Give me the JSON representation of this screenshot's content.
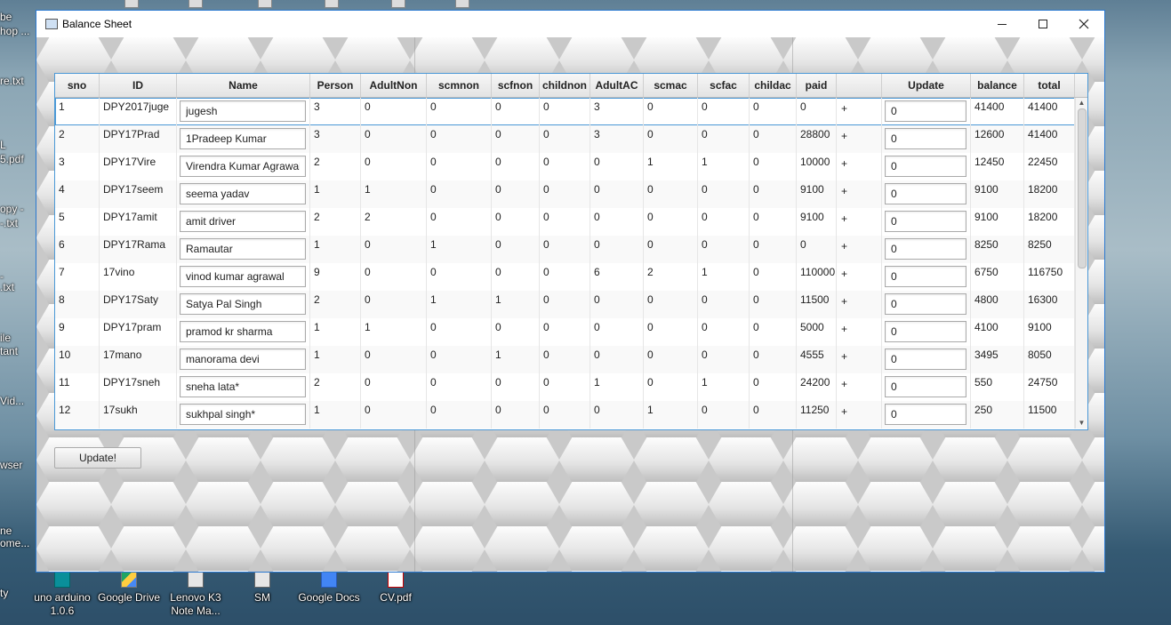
{
  "window": {
    "title": "Balance Sheet"
  },
  "desktop_left": [
    "be",
    "hop ...",
    "re.txt",
    "L",
    "5.pdf",
    "opy -",
    "-.txt",
    "-",
    ".txt",
    "ile",
    "tant",
    "Vid...",
    "wser",
    "ne",
    "ome...",
    "ty"
  ],
  "desktop_bottom": [
    {
      "label": "uno arduino",
      "label2": "1.0.6",
      "icon": "arduino-icon"
    },
    {
      "label": "Google Drive",
      "label2": "",
      "icon": "google-drive-icon"
    },
    {
      "label": "Lenovo K3",
      "label2": "Note Ma...",
      "icon": "folder-icon"
    },
    {
      "label": "SM",
      "label2": "",
      "icon": "folder-icon"
    },
    {
      "label": "Google Docs",
      "label2": "",
      "icon": "google-docs-icon"
    },
    {
      "label": "CV.pdf",
      "label2": "",
      "icon": "pdf-icon"
    }
  ],
  "columns": [
    "sno",
    "ID",
    "Name",
    "Person",
    "AdultNon",
    "scmnon",
    "scfnon",
    "childnon",
    "AdultAC",
    "scmac",
    "scfac",
    "childac",
    "paid",
    "",
    "Update",
    "balance",
    "total"
  ],
  "rows": [
    {
      "sno": "1",
      "id": "DPY2017juge",
      "name": "jugesh",
      "person": "3",
      "adultnon": "0",
      "scmnon": "0",
      "scfnon": "0",
      "childnon": "0",
      "adultac": "3",
      "scmac": "0",
      "scfac": "0",
      "childac": "0",
      "paid": "0",
      "op": "+",
      "update": "0",
      "balance": "41400",
      "total": "41400"
    },
    {
      "sno": "2",
      "id": "DPY17Prad",
      "name": "1Pradeep Kumar",
      "person": "3",
      "adultnon": "0",
      "scmnon": "0",
      "scfnon": "0",
      "childnon": "0",
      "adultac": "3",
      "scmac": "0",
      "scfac": "0",
      "childac": "0",
      "paid": "28800",
      "op": "+",
      "update": "0",
      "balance": "12600",
      "total": "41400"
    },
    {
      "sno": "3",
      "id": "DPY17Vire",
      "name": "Virendra Kumar Agrawal",
      "person": "2",
      "adultnon": "0",
      "scmnon": "0",
      "scfnon": "0",
      "childnon": "0",
      "adultac": "0",
      "scmac": "1",
      "scfac": "1",
      "childac": "0",
      "paid": "10000",
      "op": "+",
      "update": "0",
      "balance": "12450",
      "total": "22450"
    },
    {
      "sno": "4",
      "id": "DPY17seem",
      "name": "seema yadav",
      "person": "1",
      "adultnon": "1",
      "scmnon": "0",
      "scfnon": "0",
      "childnon": "0",
      "adultac": "0",
      "scmac": "0",
      "scfac": "0",
      "childac": "0",
      "paid": "9100",
      "op": "+",
      "update": "0",
      "balance": "9100",
      "total": "18200"
    },
    {
      "sno": "5",
      "id": "DPY17amit",
      "name": "amit driver",
      "person": "2",
      "adultnon": "2",
      "scmnon": "0",
      "scfnon": "0",
      "childnon": "0",
      "adultac": "0",
      "scmac": "0",
      "scfac": "0",
      "childac": "0",
      "paid": "9100",
      "op": "+",
      "update": "0",
      "balance": "9100",
      "total": "18200"
    },
    {
      "sno": "6",
      "id": "DPY17Rama",
      "name": "Ramautar",
      "person": "1",
      "adultnon": "0",
      "scmnon": "1",
      "scfnon": "0",
      "childnon": "0",
      "adultac": "0",
      "scmac": "0",
      "scfac": "0",
      "childac": "0",
      "paid": "0",
      "op": "+",
      "update": "0",
      "balance": "8250",
      "total": "8250"
    },
    {
      "sno": "7",
      "id": "17vino",
      "name": "vinod kumar agrawal",
      "person": "9",
      "adultnon": "0",
      "scmnon": "0",
      "scfnon": "0",
      "childnon": "0",
      "adultac": "6",
      "scmac": "2",
      "scfac": "1",
      "childac": "0",
      "paid": "110000",
      "op": "+",
      "update": "0",
      "balance": "6750",
      "total": "116750"
    },
    {
      "sno": "8",
      "id": "DPY17Saty",
      "name": "Satya Pal Singh",
      "person": "2",
      "adultnon": "0",
      "scmnon": "1",
      "scfnon": "1",
      "childnon": "0",
      "adultac": "0",
      "scmac": "0",
      "scfac": "0",
      "childac": "0",
      "paid": "11500",
      "op": "+",
      "update": "0",
      "balance": "4800",
      "total": "16300"
    },
    {
      "sno": "9",
      "id": "DPY17pram",
      "name": "pramod kr sharma",
      "person": "1",
      "adultnon": "1",
      "scmnon": "0",
      "scfnon": "0",
      "childnon": "0",
      "adultac": "0",
      "scmac": "0",
      "scfac": "0",
      "childac": "0",
      "paid": "5000",
      "op": "+",
      "update": "0",
      "balance": "4100",
      "total": "9100"
    },
    {
      "sno": "10",
      "id": "17mano",
      "name": "manorama devi",
      "person": "1",
      "adultnon": "0",
      "scmnon": "0",
      "scfnon": "1",
      "childnon": "0",
      "adultac": "0",
      "scmac": "0",
      "scfac": "0",
      "childac": "0",
      "paid": "4555",
      "op": "+",
      "update": "0",
      "balance": "3495",
      "total": "8050"
    },
    {
      "sno": "11",
      "id": "DPY17sneh",
      "name": "sneha lata*",
      "person": "2",
      "adultnon": "0",
      "scmnon": "0",
      "scfnon": "0",
      "childnon": "0",
      "adultac": "1",
      "scmac": "0",
      "scfac": "1",
      "childac": "0",
      "paid": "24200",
      "op": "+",
      "update": "0",
      "balance": "550",
      "total": "24750"
    },
    {
      "sno": "12",
      "id": "17sukh",
      "name": "sukhpal singh*",
      "person": "1",
      "adultnon": "0",
      "scmnon": "0",
      "scfnon": "0",
      "childnon": "0",
      "adultac": "0",
      "scmac": "1",
      "scfac": "0",
      "childac": "0",
      "paid": "11250",
      "op": "+",
      "update": "0",
      "balance": "250",
      "total": "11500"
    }
  ],
  "button": {
    "update_label": "Update!"
  },
  "colors": {
    "accent": "#2b79d0",
    "table_border": "#4a98d6"
  }
}
